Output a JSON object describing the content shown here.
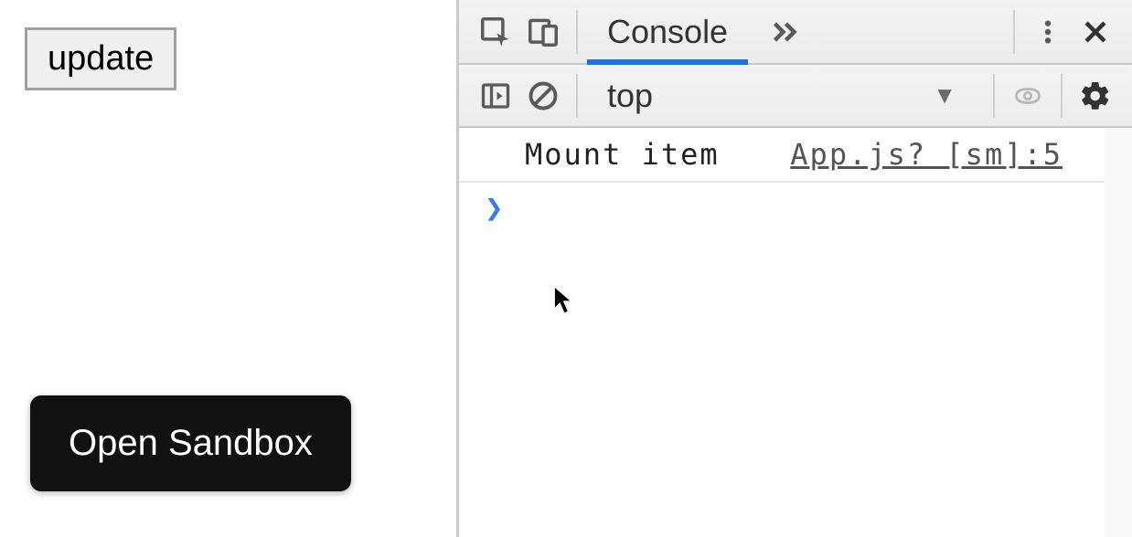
{
  "leftPane": {
    "updateButton": "update",
    "openSandboxButton": "Open Sandbox"
  },
  "devtools": {
    "tabs": {
      "console": "Console"
    },
    "contextSelector": "top",
    "icons": {
      "inspect": "inspect-element-icon",
      "device": "device-toggle-icon",
      "overflow": "chevron-double-right-icon",
      "menu": "kebab-menu-icon",
      "close": "close-icon",
      "sidebar": "sidebar-toggle-icon",
      "clear": "clear-console-icon",
      "eye": "live-expression-icon",
      "settings": "gear-icon"
    }
  },
  "console": {
    "log": {
      "message": "Mount item",
      "source": "App.js? [sm]:5"
    },
    "promptSymbol": "❯"
  }
}
